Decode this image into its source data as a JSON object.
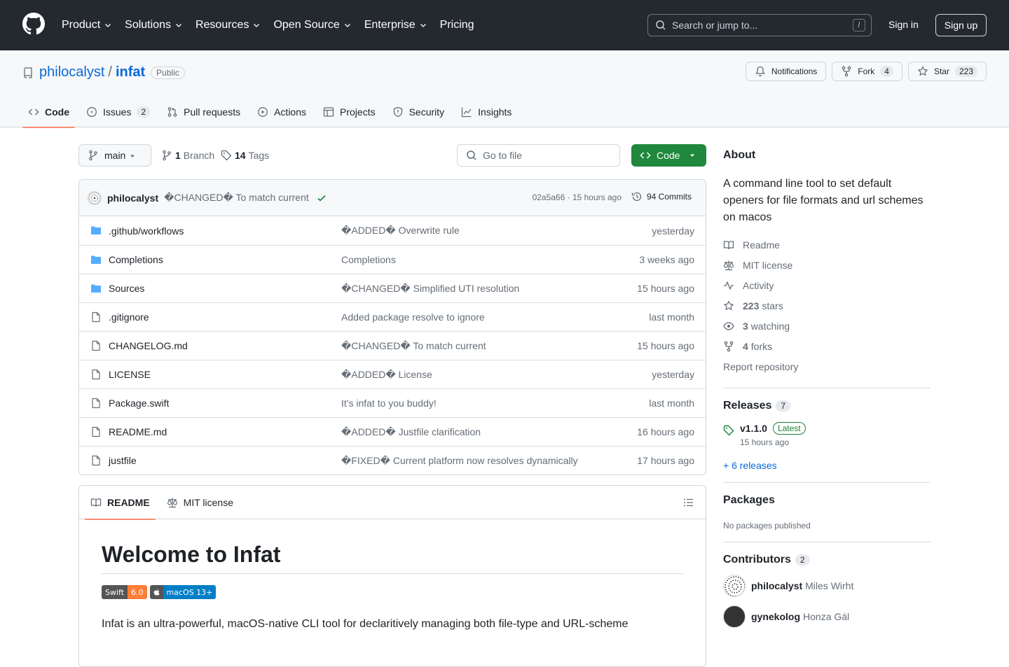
{
  "header": {
    "nav": [
      "Product",
      "Solutions",
      "Resources",
      "Open Source",
      "Enterprise",
      "Pricing"
    ],
    "search_placeholder": "Search or jump to...",
    "search_shortcut": "/",
    "sign_in": "Sign in",
    "sign_up": "Sign up"
  },
  "repo": {
    "owner": "philocalyst",
    "separator": "/",
    "name": "infat",
    "visibility": "Public",
    "notifications_label": "Notifications",
    "fork_label": "Fork",
    "fork_count": "4",
    "star_label": "Star",
    "star_count": "223",
    "tabs": [
      {
        "label": "Code",
        "icon": "code-icon"
      },
      {
        "label": "Issues",
        "count": "2",
        "icon": "issue-icon"
      },
      {
        "label": "Pull requests",
        "icon": "pull-request-icon"
      },
      {
        "label": "Actions",
        "icon": "play-icon"
      },
      {
        "label": "Projects",
        "icon": "table-icon"
      },
      {
        "label": "Security",
        "icon": "shield-icon"
      },
      {
        "label": "Insights",
        "icon": "graph-icon"
      }
    ]
  },
  "toolbar": {
    "branch": "main",
    "branch_count": "1",
    "branch_label": "Branch",
    "tag_count": "14",
    "tag_label": "Tags",
    "goto_placeholder": "Go to file",
    "code_button": "Code"
  },
  "latest_commit": {
    "author": "philocalyst",
    "message": "�CHANGED� To match current",
    "meta": "02a5a66 · 15 hours ago",
    "commits": "94 Commits"
  },
  "files": [
    {
      "type": "dir",
      "name": ".github/workflows",
      "message": "�ADDED� Overwrite rule",
      "date": "yesterday"
    },
    {
      "type": "dir",
      "name": "Completions",
      "message": "Completions",
      "date": "3 weeks ago"
    },
    {
      "type": "dir",
      "name": "Sources",
      "message": "�CHANGED� Simplified UTI resolution",
      "date": "15 hours ago"
    },
    {
      "type": "file",
      "name": ".gitignore",
      "message": "Added package resolve to ignore",
      "date": "last month"
    },
    {
      "type": "file",
      "name": "CHANGELOG.md",
      "message": "�CHANGED� To match current",
      "date": "15 hours ago"
    },
    {
      "type": "file",
      "name": "LICENSE",
      "message": "�ADDED� License",
      "date": "yesterday"
    },
    {
      "type": "file",
      "name": "Package.swift",
      "message": "It's infat to you buddy!",
      "date": "last month"
    },
    {
      "type": "file",
      "name": "README.md",
      "message": "�ADDED� Justfile clarification",
      "date": "16 hours ago"
    },
    {
      "type": "file",
      "name": "justfile",
      "message": "�FIXED� Current platform now resolves dynamically",
      "date": "17 hours ago"
    }
  ],
  "readme": {
    "tab_readme": "README",
    "tab_license": "MIT license",
    "title": "Welcome to Infat",
    "badges": [
      {
        "left": "Swift",
        "right": "6.0",
        "left_color": "#555555",
        "right_color": "#fe7d37"
      },
      {
        "left": "",
        "right": "macOS 13+",
        "left_color": "#555555",
        "right_color": "#007ec6"
      }
    ],
    "intro": "Infat is an ultra-powerful, macOS-native CLI tool for declaritively managing both file-type and URL-scheme"
  },
  "about": {
    "heading": "About",
    "description": "A command line tool to set default openers for file formats and url schemes on macos",
    "links": [
      {
        "icon": "book-icon",
        "text": "Readme"
      },
      {
        "icon": "law-icon",
        "text": "MIT license"
      },
      {
        "icon": "pulse-icon",
        "text": "Activity"
      },
      {
        "icon": "star-icon",
        "bold": "223",
        "text": "stars"
      },
      {
        "icon": "eye-icon",
        "bold": "3",
        "text": "watching"
      },
      {
        "icon": "fork-icon",
        "bold": "4",
        "text": "forks"
      }
    ],
    "report": "Report repository"
  },
  "releases": {
    "heading": "Releases",
    "count": "7",
    "tag": "v1.1.0",
    "latest": "Latest",
    "date": "15 hours ago",
    "more": "+ 6 releases"
  },
  "packages": {
    "heading": "Packages",
    "none": "No packages published"
  },
  "contributors": {
    "heading": "Contributors",
    "count": "2",
    "people": [
      {
        "login": "philocalyst",
        "name": "Miles Wirht"
      },
      {
        "login": "gynekolog",
        "name": "Honza Gál"
      }
    ]
  },
  "colors": {
    "header_bg": "#24292f",
    "link": "#0969da",
    "primary_button": "#1f883d",
    "tab_underline": "#fd8c73",
    "folder": "#54aeff"
  }
}
